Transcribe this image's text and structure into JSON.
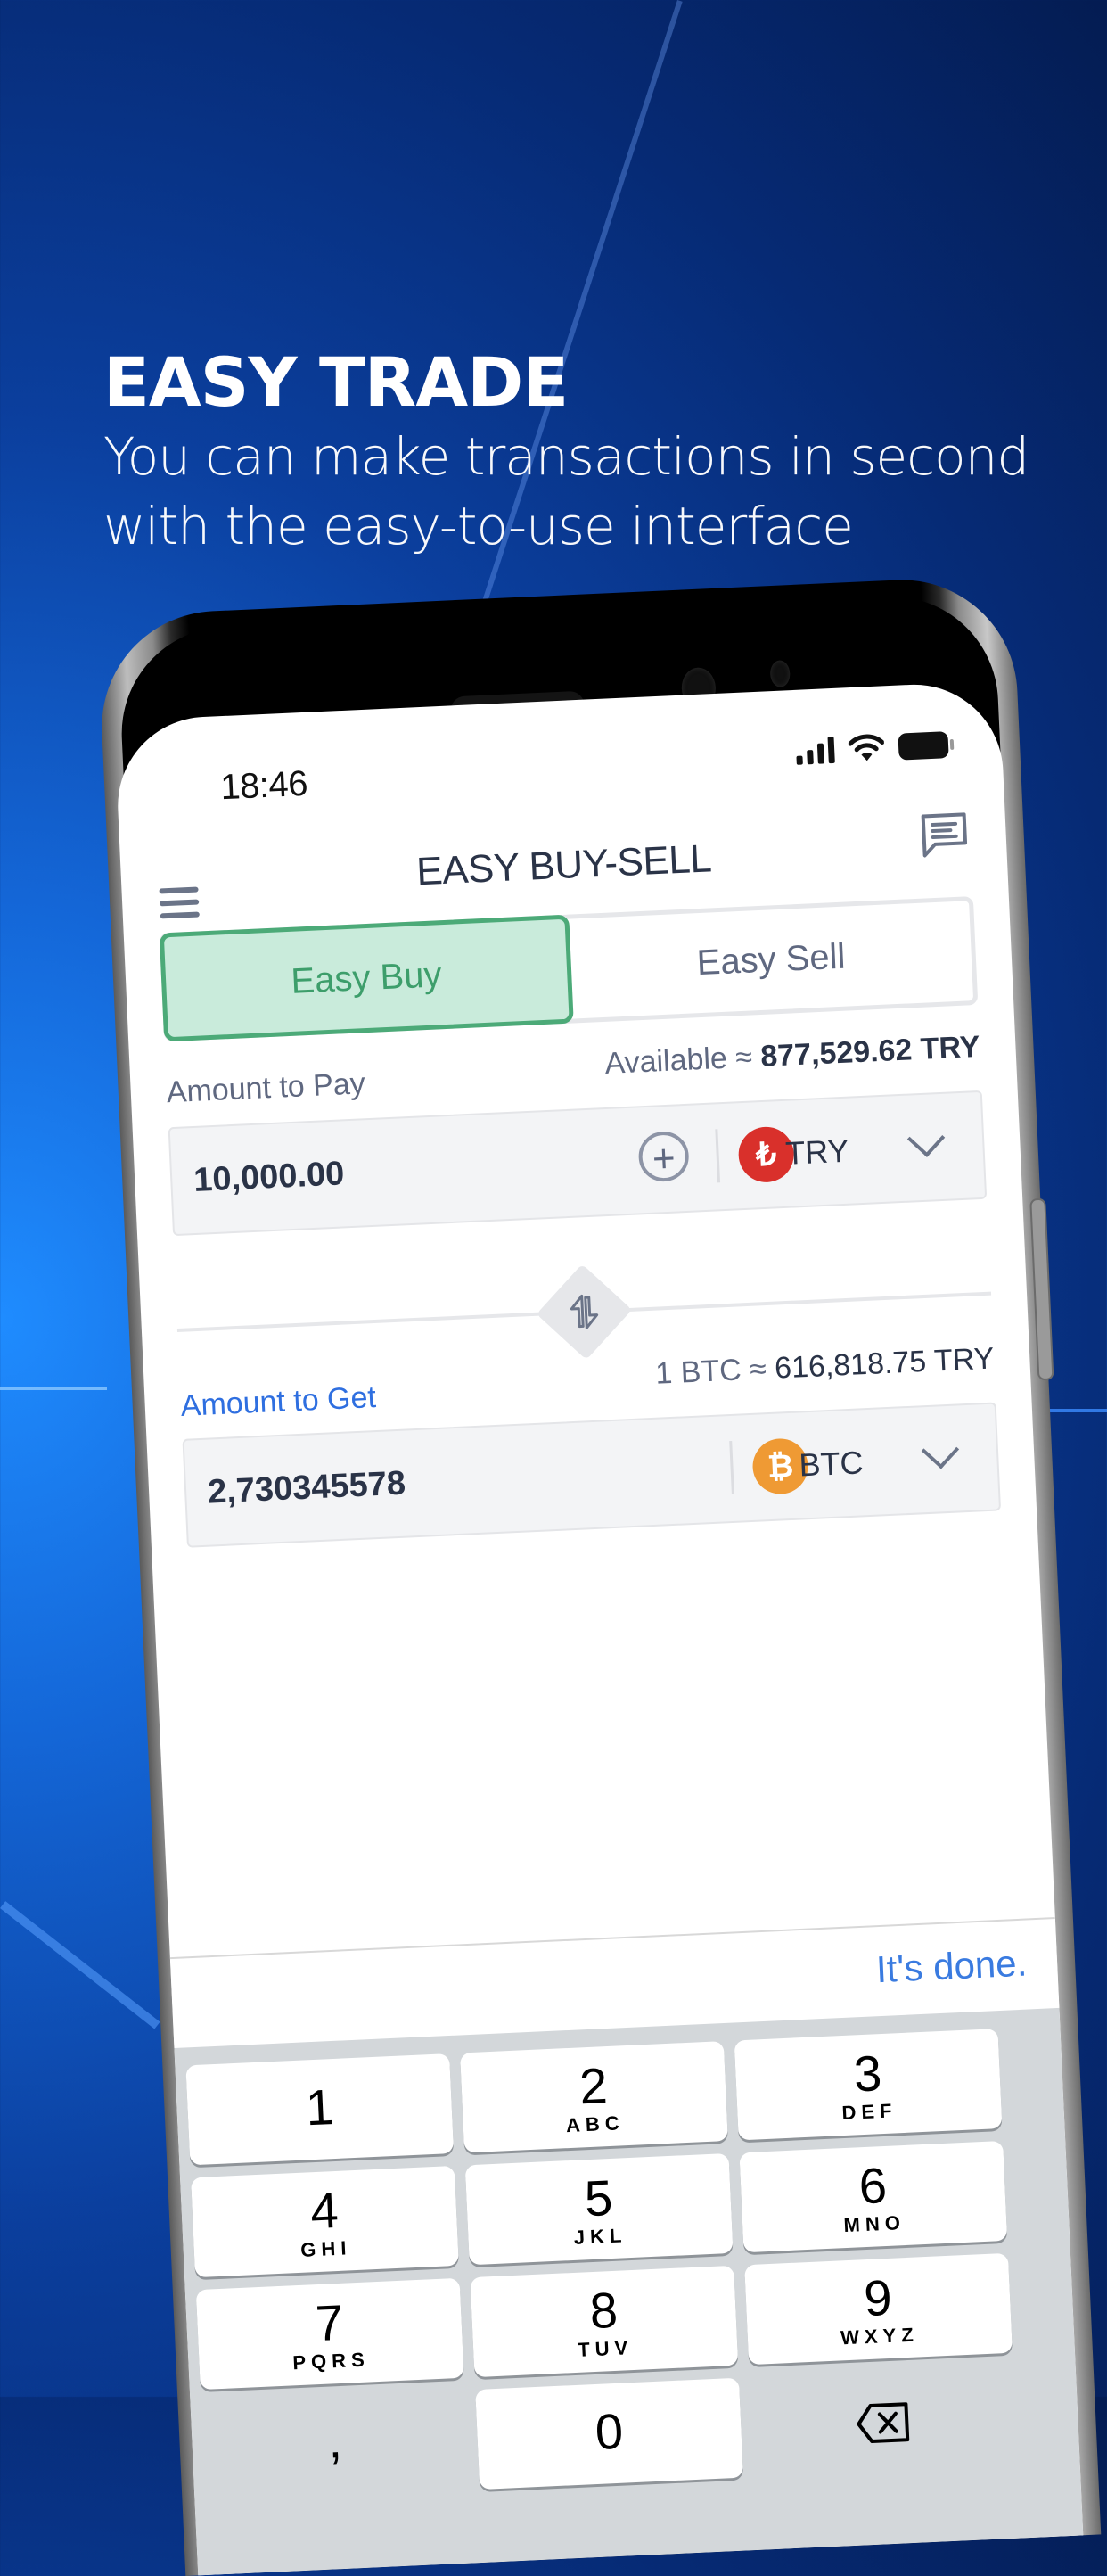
{
  "hero": {
    "title": "EASY TRADE",
    "subtitle_line1": "You can make transactions in second",
    "subtitle_line2": "with the easy-to-use interface"
  },
  "status_bar": {
    "time": "18:46",
    "icons": [
      "signal-icon",
      "wifi-icon",
      "battery-icon"
    ]
  },
  "header": {
    "title": "EASY BUY-SELL",
    "menu_icon": "hamburger-menu-icon",
    "chat_icon": "chat-message-icon"
  },
  "tabs": [
    {
      "label": "Easy Buy",
      "active": true
    },
    {
      "label": "Easy Sell",
      "active": false
    }
  ],
  "pay": {
    "label": "Amount to Pay",
    "available_prefix": "Available ≈",
    "available_value": "877,529.62 TRY",
    "value": "10,000.00",
    "currency_code": "TRY",
    "currency_symbol": "₺",
    "currency_color": "#d9302b"
  },
  "get": {
    "label": "Amount to Get",
    "rate_prefix": "1 BTC ≈",
    "rate_value": "616,818.75 TRY",
    "value": "2,730345578",
    "currency_code": "BTC",
    "currency_symbol": "₿",
    "currency_color": "#ef9a34"
  },
  "keyboard": {
    "done_label": "It's done.",
    "keys": [
      {
        "num": "1",
        "sub": ""
      },
      {
        "num": "2",
        "sub": "ABC"
      },
      {
        "num": "3",
        "sub": "DEF"
      },
      {
        "num": "4",
        "sub": "GHI"
      },
      {
        "num": "5",
        "sub": "JKL"
      },
      {
        "num": "6",
        "sub": "MNO"
      },
      {
        "num": "7",
        "sub": "PQRS"
      },
      {
        "num": "8",
        "sub": "TUV"
      },
      {
        "num": "9",
        "sub": "WXYZ"
      },
      {
        "num": ",",
        "sub": ""
      },
      {
        "num": "0",
        "sub": ""
      },
      {
        "num": "",
        "sub": ""
      }
    ]
  },
  "colors": {
    "accent_green": "#4caa78",
    "accent_blue": "#2f6fe0",
    "text_dark": "#2a3347",
    "text_muted": "#5f6880"
  }
}
